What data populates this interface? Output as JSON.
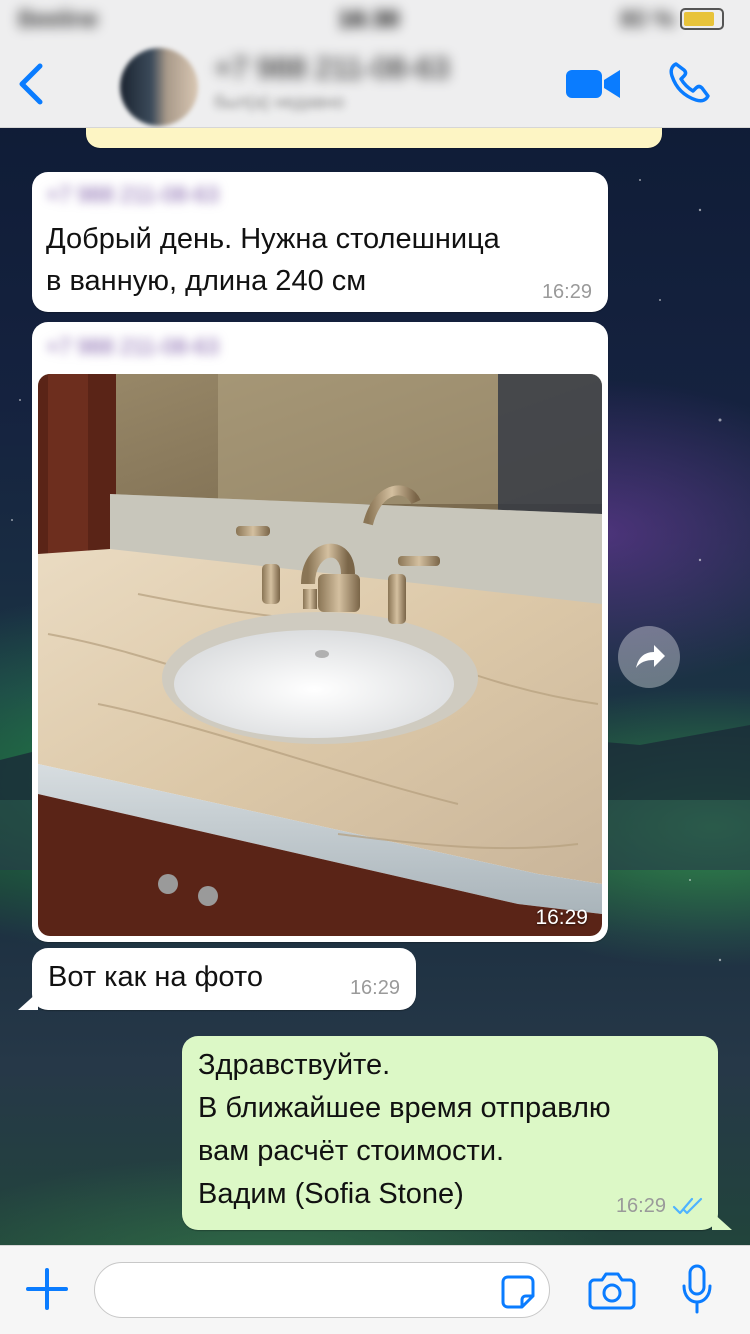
{
  "status_bar": {
    "carrier": "Beeline",
    "time": "16:30",
    "battery": "80 %"
  },
  "header": {
    "contact_name": "+7 988 211-08-63",
    "contact_status": "был(а) недавно",
    "back_icon": "chevron-left-icon",
    "video_icon": "video-camera-icon",
    "call_icon": "phone-icon"
  },
  "messages": [
    {
      "direction": "incoming",
      "sender": "+7 988 211-08-63",
      "text": "Добрый день. Нужна столешница\nв ванную, длина 240 см",
      "time": "16:29"
    },
    {
      "direction": "incoming",
      "sender": "+7 988 211-08-63",
      "type": "photo",
      "time": "16:29"
    },
    {
      "direction": "incoming",
      "text": "Вот как на фото",
      "time": "16:29"
    },
    {
      "direction": "outgoing",
      "text": "Здравствуйте.\nВ ближайшее время отправлю\nвам расчёт стоимости.\nВадим (Sofia Stone)",
      "time": "16:29",
      "status": "read"
    }
  ],
  "input_bar": {
    "placeholder": "",
    "value": ""
  },
  "colors": {
    "accent": "#0a7cff",
    "outgoing_bubble": "#dcf8c6",
    "incoming_bubble": "#ffffff",
    "read_ticks": "#4fb3ff"
  }
}
